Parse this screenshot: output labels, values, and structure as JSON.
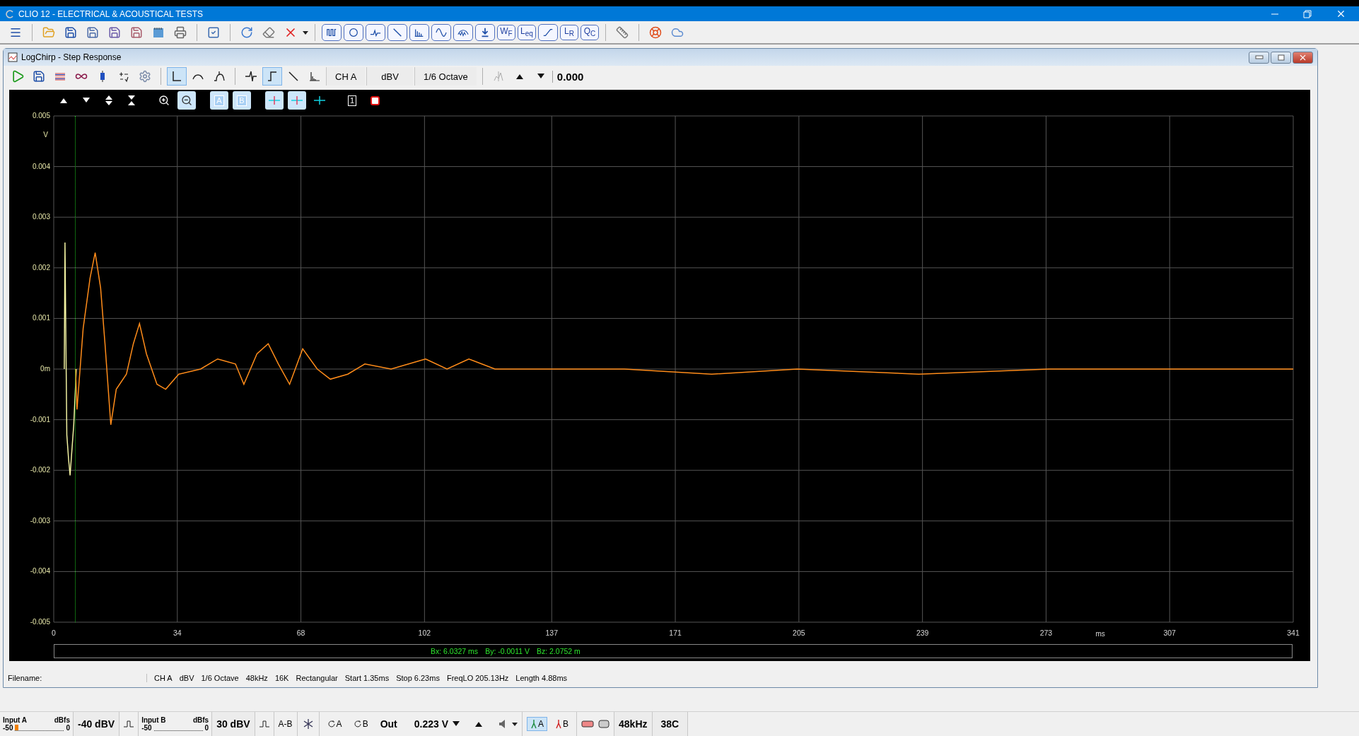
{
  "app_title": "CLIO 12 - ELECTRICAL & ACOUSTICAL TESTS",
  "main_toolbar": {
    "text_buttons": [
      "W$_{F}$",
      "L$_{eq}$",
      "L$_{R}$",
      "Q$_{C}$"
    ]
  },
  "window": {
    "title": "LogChirp - Step Response"
  },
  "toolbar": {
    "view_buttons": [
      {
        "selected": true
      },
      {
        "selected": false
      },
      {
        "selected": false
      }
    ],
    "mode_buttons": [
      {
        "selected": false
      },
      {
        "selected": true
      },
      {
        "selected": false
      },
      {
        "selected": false
      }
    ],
    "channel": "CH A",
    "unit": "dBV",
    "smoothing": "1/6 Octave",
    "value": "0.000"
  },
  "chart_toolbar": [
    {
      "kind": "up",
      "selected": false
    },
    {
      "kind": "down",
      "selected": false
    },
    {
      "kind": "expand",
      "selected": false
    },
    {
      "kind": "collapse",
      "selected": false
    },
    {
      "kind": "zoom-in",
      "selected": false
    },
    {
      "kind": "zoom-out",
      "selected": true
    },
    {
      "kind": "trace",
      "label": "A",
      "selected": true
    },
    {
      "kind": "trace",
      "label": "B",
      "selected": true
    },
    {
      "kind": "cursor",
      "selected": true
    },
    {
      "kind": "cursor",
      "selected": true
    },
    {
      "kind": "cursor",
      "selected": false
    },
    {
      "kind": "box",
      "label": "1",
      "selected": false
    },
    {
      "kind": "stop",
      "selected": false
    }
  ],
  "chart_data": {
    "type": "line",
    "xlabel": "ms",
    "ylabel": "V",
    "xlim": [
      0,
      341
    ],
    "ylim": [
      -0.005,
      0.005
    ],
    "grid": true,
    "xticks": [
      0,
      34,
      68,
      102,
      137,
      171,
      205,
      239,
      273,
      307,
      341
    ],
    "yticks": [
      -0.005,
      -0.004,
      -0.003,
      -0.002,
      -0.001,
      {
        "value": 0,
        "label": "0m"
      },
      0.001,
      0.002,
      0.003,
      0.004,
      0.005
    ],
    "series": [
      {
        "color": "#f0f0a0",
        "x": [
          2.9,
          3.1,
          3.6,
          4.1,
          4.5,
          5.5,
          6.2
        ],
        "values": [
          0,
          0.0025,
          -0.0013,
          -0.0018,
          -0.0021,
          -0.0011,
          0
        ]
      },
      {
        "color": "#ff8c1a",
        "x": [
          6,
          6.4,
          8.1,
          10,
          11.4,
          12.9,
          14.1,
          15.7,
          17.2,
          20,
          21.9,
          23.6,
          25.5,
          28.4,
          30.8,
          34.4,
          40.4,
          45.1,
          50,
          52.3,
          55.9,
          59,
          61.8,
          64.9,
          68.5,
          72.5,
          76.1,
          80.9,
          85.6,
          92.8,
          102.3,
          108.2,
          114.2,
          121.4,
          135.6,
          157,
          181,
          204.6,
          238,
          273.8,
          307,
          328.5,
          341
        ],
        "values": [
          0,
          -0.0008,
          0.0008,
          0.0018,
          0.0023,
          0.0016,
          0.0005,
          -0.0011,
          -0.0004,
          -0.0001,
          0.0005,
          0.0009,
          0.0003,
          -0.0003,
          -0.0004,
          -0.0001,
          0,
          0.0002,
          0.0001,
          -0.0003,
          0.0003,
          0.0005,
          0.0001,
          -0.0003,
          0.0004,
          0,
          -0.0002,
          -0.0001,
          0.0001,
          0,
          0.0002,
          0,
          0.0002,
          0,
          0,
          0,
          -0.0001,
          0,
          -0.0001,
          0,
          0,
          0,
          0
        ]
      }
    ]
  },
  "readout": [
    "Bx: 6.0327 ms",
    "By: -0.0011 V",
    "Bz: 2.0752 m"
  ],
  "status": {
    "filename_label": "Filename:",
    "items": [
      "CH A",
      "dBV",
      "1/6 Octave",
      "48kHz",
      "16K",
      "Rectangular",
      "Start 1.35ms",
      "Stop 6.23ms",
      "FreqLO 205.13Hz",
      "Length 4.88ms"
    ]
  },
  "bottom_bar": {
    "inputs": [
      {
        "label": "Input A",
        "unit": "dBfs",
        "scale_min": "-50",
        "scale_max": "0",
        "level": 0.06,
        "range": "-40 dBV"
      },
      {
        "label": "Input B",
        "unit": "dBfs",
        "scale_min": "-50",
        "scale_max": "0",
        "range": "30 dBV"
      }
    ],
    "difference": "A-B",
    "loops": [
      "A",
      "B"
    ],
    "out_label": "Out",
    "out_value": "0.223 V",
    "probes": [
      {
        "label": "A",
        "selected": true
      },
      {
        "label": "B",
        "selected": false
      }
    ],
    "sample_rate": "48kHz",
    "temperature": "38C"
  }
}
